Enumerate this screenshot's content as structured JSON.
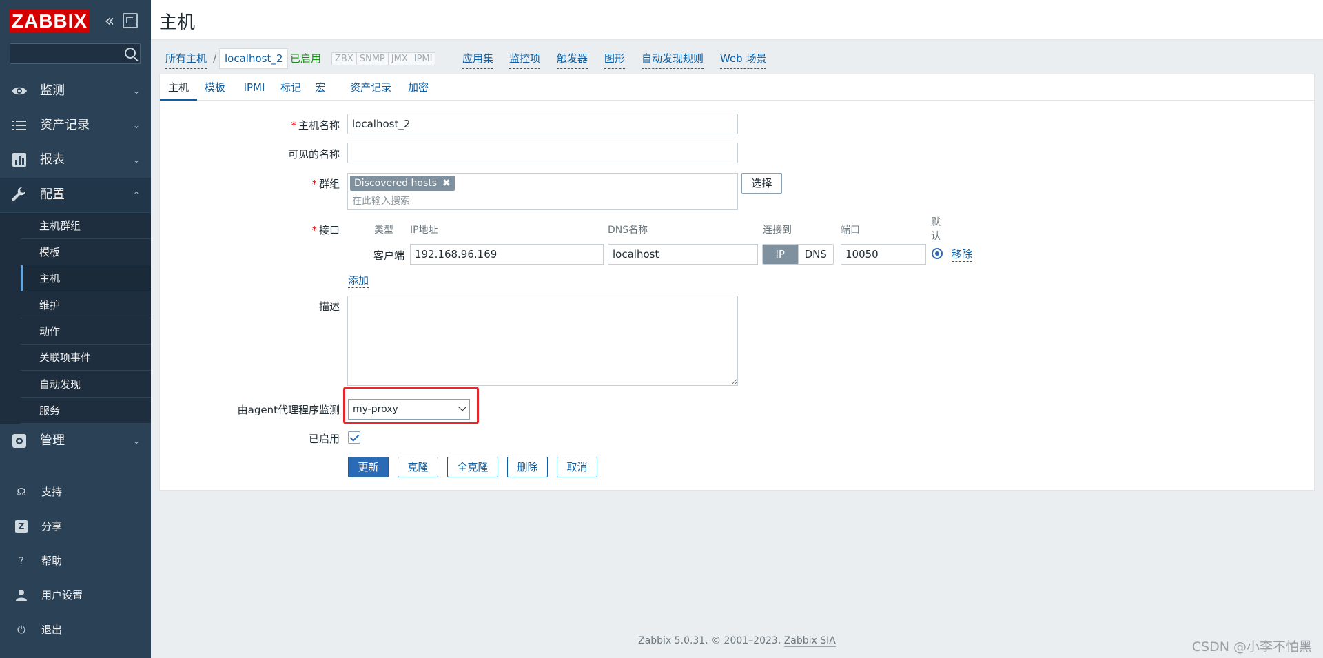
{
  "app": {
    "logo": "ZABBIX",
    "page_title": "主机",
    "footer": {
      "version": "Zabbix 5.0.31. © 2001–2023, ",
      "company": "Zabbix SIA"
    },
    "watermark": "CSDN @小李不怕黑"
  },
  "sidebar": {
    "search_placeholder": "",
    "main_items": [
      {
        "label": "监测",
        "icon": "eye-icon"
      },
      {
        "label": "资产记录",
        "icon": "list-icon"
      },
      {
        "label": "报表",
        "icon": "chart-icon"
      },
      {
        "label": "配置",
        "icon": "wrench-icon"
      },
      {
        "label": "管理",
        "icon": "gear-icon"
      }
    ],
    "config_submenu": [
      "主机群组",
      "模板",
      "主机",
      "维护",
      "动作",
      "关联项事件",
      "自动发现",
      "服务"
    ],
    "active_submenu": "主机",
    "bottom_items": [
      {
        "label": "支持",
        "icon": "headset-icon"
      },
      {
        "label": "分享",
        "icon": "share-icon"
      },
      {
        "label": "帮助",
        "icon": "help-icon"
      },
      {
        "label": "用户设置",
        "icon": "user-icon"
      },
      {
        "label": "退出",
        "icon": "power-icon"
      }
    ]
  },
  "breadcrumb": {
    "all_hosts": "所有主机",
    "separator": "/",
    "current": "localhost_2",
    "status": "已启用",
    "protocols": [
      "ZBX",
      "SNMP",
      "JMX",
      "IPMI"
    ],
    "links": [
      "应用集",
      "监控项",
      "触发器",
      "图形",
      "自动发现规则",
      "Web 场景"
    ]
  },
  "tabs": [
    "主机",
    "模板",
    "IPMI",
    "标记",
    "宏",
    "资产记录",
    "加密"
  ],
  "active_tab": "主机",
  "form": {
    "host_name_label": "主机名称",
    "host_name_value": "localhost_2",
    "visible_name_label": "可见的名称",
    "visible_name_value": "",
    "groups_label": "群组",
    "group_chip": "Discovered hosts",
    "groups_placeholder": "在此输入搜索",
    "select_button": "选择",
    "interfaces_label": "接口",
    "iface_headers": {
      "type": "类型",
      "ip": "IP地址",
      "dns": "DNS名称",
      "connect": "连接到",
      "port": "端口",
      "default": "默认"
    },
    "iface_row": {
      "type": "客户端",
      "ip": "192.168.96.169",
      "dns": "localhost",
      "connect_ip": "IP",
      "connect_dns": "DNS",
      "port": "10050",
      "remove": "移除"
    },
    "add_link": "添加",
    "description_label": "描述",
    "description_value": "",
    "proxy_label": "由agent代理程序监测",
    "proxy_value": "my-proxy",
    "enabled_label": "已启用",
    "enabled": true,
    "buttons": {
      "update": "更新",
      "clone": "克隆",
      "full_clone": "全克隆",
      "delete": "删除",
      "cancel": "取消"
    }
  },
  "colors": {
    "sidebar": "#2b4156",
    "accent": "#0a5fa6",
    "logo_red": "#d40000",
    "highlight_red": "#e8262b",
    "enabled_green": "#1a8a1a"
  }
}
